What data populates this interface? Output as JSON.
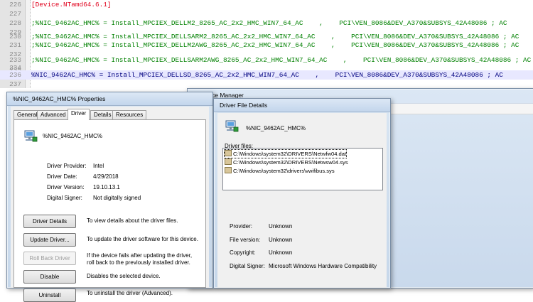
{
  "editor": {
    "lines": [
      {
        "num": "226",
        "text": "[Device.NTamd64.6.1]",
        "kind": "section"
      },
      {
        "num": "227",
        "text": "",
        "kind": "blank"
      },
      {
        "num": "228",
        "text": ";%NIC_9462AC_HMC% = Install_MPCIEX_DELLM2_8265_AC_2x2_HMC_WIN7_64_AC    ,    PCI\\VEN_8086&DEV_A370&SUBSYS_42A48086 ; AC",
        "kind": "comment"
      },
      {
        "num": "229",
        "text": "",
        "kind": "blank"
      },
      {
        "num": "230",
        "text": ";%NIC_9462AC_HMC% = Install_MPCIEX_DELLSARM2_8265_AC_2x2_HMC_WIN7_64_AC    ,    PCI\\VEN_8086&DEV_A370&SUBSYS_42A48086 ; AC",
        "kind": "comment"
      },
      {
        "num": "231",
        "text": ";%NIC_9462AC_HMC% = Install_MPCIEX_DELLM2AWG_8265_AC_2x2_HMC_WIN7_64_AC    ,    PCI\\VEN_8086&DEV_A370&SUBSYS_42A48086 ; AC",
        "kind": "comment"
      },
      {
        "num": "232",
        "text": "",
        "kind": "blank"
      },
      {
        "num": "233",
        "text": ";%NIC_9462AC_HMC% = Install_MPCIEX_DELLSARM2AWG_8265_AC_2x2_HMC_WIN7_64_AC    ,    PCI\\VEN_8086&DEV_A370&SUBSYS_42A48086 ; AC",
        "kind": "comment"
      },
      {
        "num": "234",
        "text": "",
        "kind": "blank"
      },
      {
        "num": "235",
        "text": "",
        "kind": "blank"
      },
      {
        "num": "236",
        "text": "%NIC_9462AC_HMC% = Install_MPCIEX_DELLSD_8265_AC_2x2_HMC_WIN7_64_AC    ,    PCI\\VEN_8086&DEV_A370&SUBSYS_42A48086 ; AC",
        "kind": "current"
      },
      {
        "num": "237",
        "text": "",
        "kind": "blank"
      },
      {
        "num": "238",
        "text": "",
        "kind": "blank"
      }
    ]
  },
  "device_manager": {
    "title": "ce Manager"
  },
  "properties": {
    "title": "%NIC_9462AC_HMC% Properties",
    "tabs": [
      "General",
      "Advanced",
      "Driver",
      "Details",
      "Resources"
    ],
    "active_tab": "Driver",
    "device_name": "%NIC_9462AC_HMC%",
    "fields": [
      {
        "label": "Driver Provider:",
        "value": "Intel"
      },
      {
        "label": "Driver Date:",
        "value": "4/29/2018"
      },
      {
        "label": "Driver Version:",
        "value": "19.10.13.1"
      },
      {
        "label": "Digital Signer:",
        "value": "Not digitally signed"
      }
    ],
    "actions": [
      {
        "label": "Driver Details",
        "desc": "To view details about the driver files.",
        "enabled": true
      },
      {
        "label": "Update Driver...",
        "desc": "To update the driver software for this device.",
        "enabled": true
      },
      {
        "label": "Roll Back Driver",
        "desc": "If the device fails after updating the driver, roll back to the previously installed driver.",
        "enabled": false
      },
      {
        "label": "Disable",
        "desc": "Disables the selected device.",
        "enabled": true
      },
      {
        "label": "Uninstall",
        "desc": "To uninstall the driver (Advanced).",
        "enabled": true
      }
    ]
  },
  "driver_file_details": {
    "title": "Driver File Details",
    "device_name": "%NIC_9462AC_HMC%",
    "files_label": "Driver files:",
    "files": [
      "C:\\Windows\\system32\\DRIVERS\\Netwfw04.dat",
      "C:\\Windows\\system32\\DRIVERS\\Netwsw04.sys",
      "C:\\Windows\\system32\\drivers\\vwifibus.sys"
    ],
    "selected_file_index": 0,
    "fields": [
      {
        "label": "Provider:",
        "value": "Unknown"
      },
      {
        "label": "File version:",
        "value": "Unknown"
      },
      {
        "label": "Copyright:",
        "value": "Unknown"
      },
      {
        "label": "Digital Signer:",
        "value": "Microsoft Windows Hardware Compatibility"
      }
    ]
  },
  "colors": {
    "comment": "#008000",
    "section": "#e0001c",
    "current_line_bg": "#e8e8ff",
    "window_frame": "#c6d7ea"
  },
  "icons": [
    "network-adapter-icon",
    "file-icon"
  ]
}
